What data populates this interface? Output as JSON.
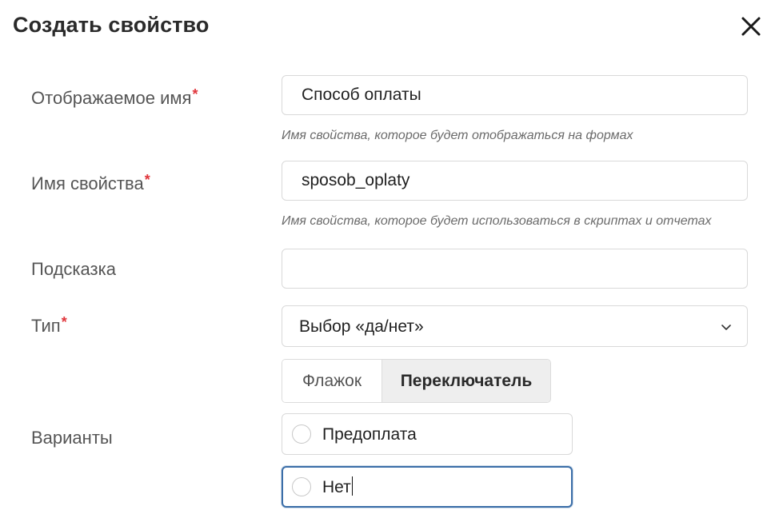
{
  "dialog": {
    "title": "Создать свойство",
    "close_icon": "close-icon"
  },
  "fields": {
    "display_name": {
      "label": "Отображаемое имя",
      "required_mark": "*",
      "value": "Способ оплаты",
      "hint": "Имя свойства, которое будет отображаться на формах"
    },
    "property_name": {
      "label": "Имя свойства",
      "required_mark": "*",
      "value": "sposob_oplaty",
      "hint": "Имя свойства, которое будет использоваться в скриптах и отчетах"
    },
    "tooltip": {
      "label": "Подсказка",
      "value": ""
    },
    "type": {
      "label": "Тип",
      "required_mark": "*",
      "selected": "Выбор «да/нет»",
      "chevron_icon": "chevron-down-icon"
    },
    "view_toggle": {
      "options": [
        "Флажок",
        "Переключатель"
      ],
      "active": "Переключатель"
    },
    "variants": {
      "label": "Варианты",
      "items": [
        "Предоплата",
        "Нет"
      ]
    }
  },
  "colors": {
    "required": "#e0353b",
    "focus_border": "#3b6ea8",
    "active_segment_bg": "#eeeeee"
  }
}
